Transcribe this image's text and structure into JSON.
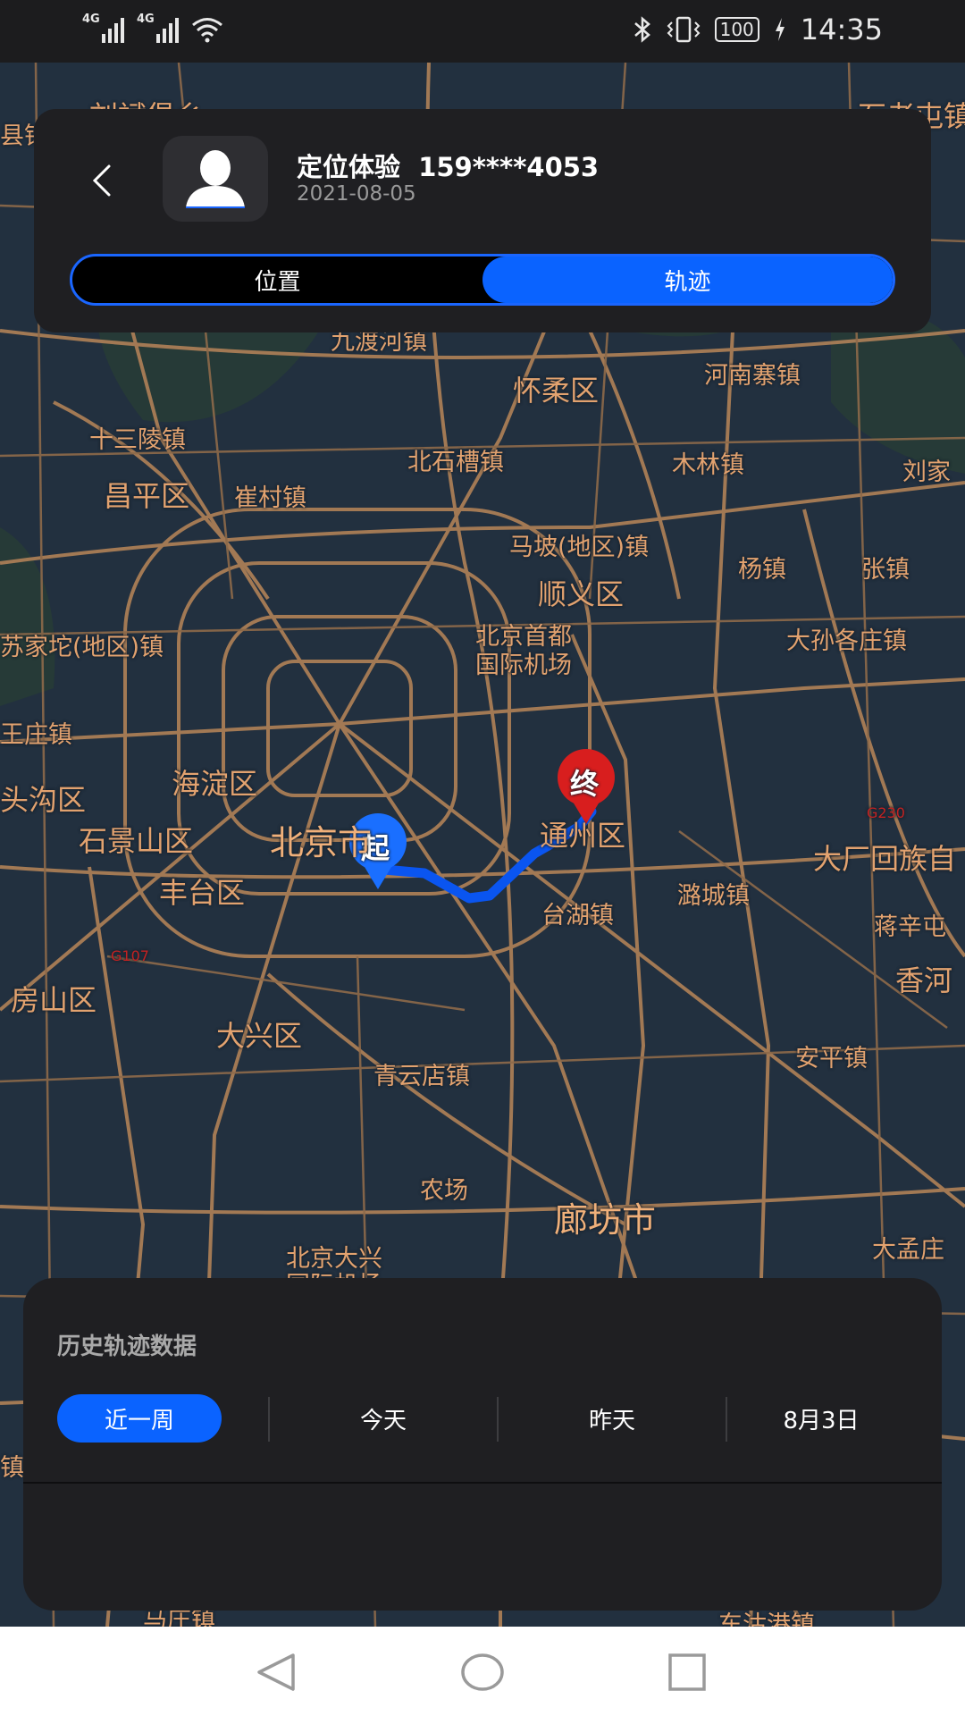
{
  "status_bar": {
    "signal_1": "4G",
    "signal_2": "4G",
    "battery": "100",
    "time": "14:35"
  },
  "header": {
    "name": "定位体验  159****4053",
    "date": "2021-08-05",
    "tabs": [
      "位置",
      "轨迹"
    ],
    "active_tab": "轨迹"
  },
  "map": {
    "start_marker": "起",
    "end_marker": "终",
    "road_code_1": "G230",
    "road_code_2": "G107",
    "places": [
      "刘斌堡乡",
      "石老屯镇",
      "九渡河镇",
      "怀柔区",
      "河南寨镇",
      "十三陵镇",
      "北石槽镇",
      "木林镇",
      "刘家",
      "昌平区",
      "崔村镇",
      "马坡(地区)镇",
      "杨镇",
      "张镇",
      "顺义区",
      "北京首都",
      "国际机场",
      "大孙各庄镇",
      "苏家坨(地区)镇",
      "王庄镇",
      "海淀区",
      "头沟区",
      "石景山区",
      "北京市",
      "通州区",
      "大厂回族自",
      "丰台区",
      "潞城镇",
      "台湖镇",
      "蒋辛屯",
      "房山区",
      "香河",
      "大兴区",
      "安平镇",
      "青云店镇",
      "农场",
      "廊坊市",
      "北京大兴",
      "国际机场",
      "大孟庄",
      "东沽港镇",
      "马庄镇",
      "县镇",
      "镇"
    ]
  },
  "history_panel": {
    "title": "历史轨迹数据",
    "filters": [
      "近一周",
      "今天",
      "昨天",
      "8月3日"
    ],
    "active_filter": "近一周"
  },
  "colors": {
    "accent": "#0a63ff",
    "end_marker": "#d81e1e",
    "road": "#b0865c",
    "map_bg": "#22303f"
  }
}
